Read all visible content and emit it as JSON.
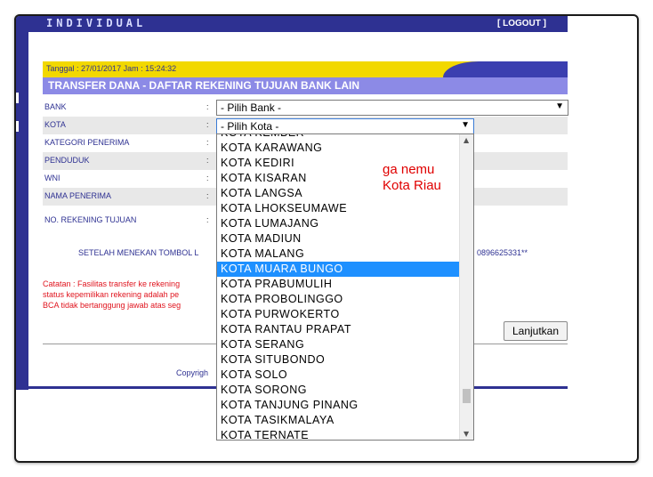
{
  "header": {
    "title": "INDIVIDUAL",
    "logout_label": "[ LOGOUT ]"
  },
  "datebar": {
    "text": "Tanggal : 27/01/2017 Jam : 15:24:32"
  },
  "page_title": "TRANSFER DANA - DAFTAR REKENING TUJUAN BANK LAIN",
  "form": {
    "colon": ":",
    "bank": {
      "label": "BANK",
      "value": "- Pilih Bank -"
    },
    "kota": {
      "label": "KOTA",
      "value": "- Pilih Kota -"
    },
    "kategori": {
      "label": "KATEGORI PENERIMA"
    },
    "penduduk": {
      "label": "PENDUDUK"
    },
    "wni": {
      "label": "WNI"
    },
    "nama": {
      "label": "NAMA PENERIMA"
    },
    "norek": {
      "label": "NO. REKENING TUJUAN"
    }
  },
  "info_left": "SETELAH MENEKAN TOMBOL L",
  "info_right": "0896625331**",
  "notes": [
    "Catatan : Fasilitas transfer ke rekening",
    "status kepemilikan rekening adalah pe",
    "BCA tidak bertanggung jawab atas seg"
  ],
  "continue_label": "Lanjutkan",
  "copyright": "Copyrigh",
  "dropdown": {
    "partial_top": "KOTA KEMBER",
    "options": [
      "KOTA KARAWANG",
      "KOTA KEDIRI",
      "KOTA KISARAN",
      "KOTA LANGSA",
      "KOTA LHOKSEUMAWE",
      "KOTA LUMAJANG",
      "KOTA MADIUN",
      "KOTA MALANG",
      "KOTA MUARA BUNGO",
      "KOTA PRABUMULIH",
      "KOTA PROBOLINGGO",
      "KOTA PURWOKERTO",
      "KOTA RANTAU PRAPAT",
      "KOTA SERANG",
      "KOTA SITUBONDO",
      "KOTA SOLO",
      "KOTA SORONG",
      "KOTA TANJUNG PINANG",
      "KOTA TASIKMALAYA",
      "KOTA TERNATE"
    ],
    "highlighted": "KOTA MUARA BUNGO"
  },
  "annotation": {
    "line1": "ga nemu",
    "line2": "Kota Riau"
  },
  "colors": {
    "brand": "#2e3192",
    "yellow": "#f2d800",
    "title_bar": "#8c8ae6",
    "highlight": "#1e90ff",
    "annotation": "#e00000"
  }
}
